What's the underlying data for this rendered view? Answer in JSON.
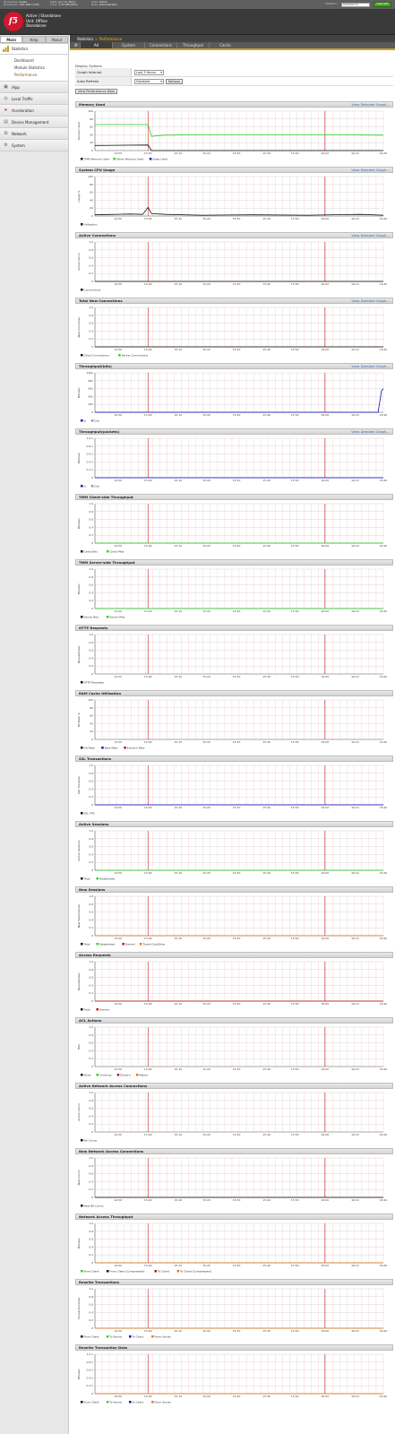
{
  "topbar": {
    "hostname_label": "Hostname:",
    "hostname": "bigip1",
    "ip_label": "IP Address:",
    "ip": "192.168.1.245",
    "date_label": "Date:",
    "date": "Jun 14, 2011",
    "time_label": "Time:",
    "time": "1:33 PM (PDT)",
    "user_label": "User:",
    "user": "admin",
    "role_label": "Role:",
    "role": "Administrator",
    "partition_label": "Partition:",
    "partition": "Common",
    "logout": "Log out"
  },
  "brand": {
    "logo": "f5",
    "status_lines": [
      "Active | Standalone",
      "Unit: Offline",
      "Standalone"
    ]
  },
  "sidebar": {
    "tabs": [
      {
        "label": "Main"
      },
      {
        "label": "Help"
      },
      {
        "label": "About"
      }
    ],
    "statistics": {
      "label": "Statistics",
      "icon": "chart-icon",
      "subitems": [
        {
          "label": "Dashboard"
        },
        {
          "label": "Module Statistics"
        },
        {
          "label": "Performance"
        }
      ]
    },
    "items": [
      {
        "label": "iApp",
        "icon": "iapp-icon"
      },
      {
        "label": "Local Traffic",
        "icon": "traffic-icon"
      },
      {
        "label": "Acceleration",
        "icon": "acceleration-icon"
      },
      {
        "label": "Device Management",
        "icon": "device-icon"
      },
      {
        "label": "Network",
        "icon": "network-icon"
      },
      {
        "label": "System",
        "icon": "system-icon"
      }
    ]
  },
  "breadcrumb": {
    "section": "Statistics",
    "sep": "»",
    "current": "Performance"
  },
  "tabs": [
    {
      "label": "All"
    },
    {
      "label": "System"
    },
    {
      "label": "Connections"
    },
    {
      "label": "Throughput"
    },
    {
      "label": "Cache"
    }
  ],
  "options": {
    "title": "Display Options",
    "interval_label": "Graph Interval",
    "interval_value": "Last 3 Hours",
    "refresh_label": "Auto Refresh",
    "refresh_value": "Disabled",
    "refresh_button": "Refresh",
    "detail_button": "View Performance Data"
  },
  "detail_link": "View Detailed Graph...",
  "x_ticks": [
    "14:50",
    "15:00",
    "15:10",
    "15:20",
    "15:30",
    "15:40",
    "15:50",
    "16:00",
    "16:10",
    "16:20"
  ],
  "colors": {
    "grid_h": "#d4d4d4",
    "grid_v": "#f0b7b7",
    "marker": "#cc2020",
    "axis": "#666",
    "green": "#2bd12b",
    "blue": "#0c0cc8",
    "black": "#111",
    "orange": "#e07a1a",
    "red": "#c01010",
    "gray": "#999"
  },
  "charts": [
    {
      "title": "Memory Used",
      "link": true,
      "ylabel": "Percent Used",
      "yticks": [
        "100",
        "80",
        "60",
        "40",
        "20",
        "0"
      ],
      "legend": [
        {
          "label": "TMM Memory Used",
          "color": "#111"
        },
        {
          "label": "Other Memory Used",
          "color": "#2bd12b"
        },
        {
          "label": "Swap Used",
          "color": "#0c0cc8"
        }
      ],
      "chart_data": {
        "type": "line",
        "series": [
          {
            "color": "#2bd12b",
            "points": [
              [
                14.7,
                66
              ],
              [
                15.0,
                66
              ],
              [
                15.02,
                36
              ],
              [
                15.06,
                38
              ],
              [
                15.1,
                39
              ],
              [
                15.3,
                40
              ],
              [
                16.0,
                40
              ],
              [
                16.33,
                39
              ]
            ]
          },
          {
            "color": "#111",
            "points": [
              [
                14.7,
                13
              ],
              [
                15.0,
                14
              ],
              [
                15.02,
                0
              ],
              [
                16.33,
                0
              ]
            ]
          }
        ]
      }
    },
    {
      "title": "System CPU Usage",
      "link": true,
      "ylabel": "Usage %",
      "yticks": [
        "100",
        "80",
        "60",
        "40",
        "20",
        "0"
      ],
      "legend": [
        {
          "label": "Utilization",
          "color": "#111"
        }
      ],
      "chart_data": {
        "type": "line",
        "series": [
          {
            "color": "#111",
            "points": [
              [
                14.7,
                3
              ],
              [
                14.9,
                5
              ],
              [
                14.97,
                4
              ],
              [
                15.0,
                22
              ],
              [
                15.02,
                6
              ],
              [
                15.1,
                4
              ],
              [
                15.3,
                2
              ],
              [
                15.6,
                3
              ],
              [
                15.9,
                2
              ],
              [
                16.2,
                4
              ],
              [
                16.33,
                2
              ]
            ]
          }
        ]
      }
    },
    {
      "title": "Active Connections",
      "link": true,
      "ylabel": "Active Conns",
      "yticks": [
        "1.0",
        "0.8",
        "0.6",
        "0.4",
        "0.2",
        "0"
      ],
      "legend": [
        {
          "label": "Connections",
          "color": "#111"
        }
      ],
      "chart_data": {
        "type": "line",
        "series": [
          {
            "color": "#111",
            "points": [
              [
                14.7,
                0
              ],
              [
                16.33,
                0
              ]
            ]
          }
        ]
      }
    },
    {
      "title": "Total New Connections",
      "link": true,
      "ylabel": "New Conns/sec",
      "yticks": [
        "1.0",
        "0.8",
        "0.6",
        "0.4",
        "0.2",
        "0"
      ],
      "legend": [
        {
          "label": "Client Connections",
          "color": "#111"
        },
        {
          "label": "Server Connections",
          "color": "#2bd12b"
        }
      ],
      "chart_data": {
        "type": "line",
        "series": [
          {
            "color": "#111",
            "points": [
              [
                14.7,
                0
              ],
              [
                16.33,
                0
              ]
            ]
          }
        ]
      }
    },
    {
      "title": "Throughput(bits)",
      "link": true,
      "ylabel": "Bits/sec",
      "yticks": [
        "100k",
        "80k",
        "60k",
        "40k",
        "20k",
        "0"
      ],
      "legend": [
        {
          "label": "In",
          "color": "#0c0cc8"
        },
        {
          "label": "Out",
          "color": "#999"
        }
      ],
      "chart_data": {
        "type": "line",
        "series": [
          {
            "color": "#0c0cc8",
            "points": [
              [
                14.7,
                0
              ],
              [
                16.3,
                0
              ],
              [
                16.32,
                55
              ],
              [
                16.33,
                60
              ]
            ]
          }
        ]
      }
    },
    {
      "title": "Throughput(packets)",
      "link": true,
      "ylabel": "Pkts/sec",
      "yticks": [
        "1.0 k",
        "0.8 k",
        "0.6 k",
        "0.4 k",
        "0.2 k",
        "0"
      ],
      "legend": [
        {
          "label": "In",
          "color": "#0c0cc8"
        },
        {
          "label": "Out",
          "color": "#999"
        }
      ],
      "chart_data": {
        "type": "line",
        "series": [
          {
            "color": "#0c0cc8",
            "points": [
              [
                14.7,
                0
              ],
              [
                16.33,
                0
              ]
            ]
          }
        ]
      }
    },
    {
      "title": "TMM Client-side Throughput",
      "link": false,
      "ylabel": "Bits/sec",
      "yticks": [
        "1.0",
        "0.8",
        "0.6",
        "0.4",
        "0.2",
        "0"
      ],
      "legend": [
        {
          "label": "Client Bits",
          "color": "#111"
        },
        {
          "label": "Client Pkts",
          "color": "#2bd12b"
        }
      ],
      "chart_data": {
        "type": "line",
        "series": [
          {
            "color": "#2bd12b",
            "points": [
              [
                14.7,
                0
              ],
              [
                16.33,
                0
              ]
            ]
          }
        ]
      }
    },
    {
      "title": "TMM Server-side Throughput",
      "link": false,
      "ylabel": "Bits/sec",
      "yticks": [
        "1.0",
        "0.8",
        "0.6",
        "0.4",
        "0.2",
        "0"
      ],
      "legend": [
        {
          "label": "Server Bits",
          "color": "#111"
        },
        {
          "label": "Server Pkts",
          "color": "#2bd12b"
        }
      ],
      "chart_data": {
        "type": "line",
        "series": [
          {
            "color": "#2bd12b",
            "points": [
              [
                14.7,
                0
              ],
              [
                16.33,
                0
              ]
            ]
          }
        ]
      }
    },
    {
      "title": "HTTP Requests",
      "link": false,
      "ylabel": "Requests/sec",
      "yticks": [
        "1.0",
        "0.8",
        "0.6",
        "0.4",
        "0.2",
        "0"
      ],
      "legend": [
        {
          "label": "HTTP Requests",
          "color": "#111"
        }
      ],
      "chart_data": {
        "type": "line",
        "series": []
      }
    },
    {
      "title": "RAM Cache Utilization",
      "link": false,
      "ylabel": "Hit Rate %",
      "yticks": [
        "100",
        "80",
        "60",
        "40",
        "20",
        "0"
      ],
      "legend": [
        {
          "label": "Hit Rate",
          "color": "#111"
        },
        {
          "label": "Byte Rate",
          "color": "#0c0cc8"
        },
        {
          "label": "Eviction Rate",
          "color": "#c01010"
        }
      ],
      "chart_data": {
        "type": "line",
        "series": []
      }
    },
    {
      "title": "SSL Transactions",
      "link": false,
      "ylabel": "SSL Trans/sec",
      "yticks": [
        "1.0",
        "0.8",
        "0.6",
        "0.4",
        "0.2",
        "0"
      ],
      "legend": [
        {
          "label": "SSL TPS",
          "color": "#111"
        }
      ],
      "chart_data": {
        "type": "line",
        "series": [
          {
            "color": "#0c0cc8",
            "points": [
              [
                14.7,
                0
              ],
              [
                16.33,
                0
              ]
            ]
          }
        ]
      }
    },
    {
      "title": "Active Sessions",
      "link": false,
      "ylabel": "Active Sessions",
      "yticks": [
        "1.0",
        "0.8",
        "0.6",
        "0.4",
        "0.2",
        "0"
      ],
      "legend": [
        {
          "label": "Total",
          "color": "#111"
        },
        {
          "label": "Established",
          "color": "#2bd12b"
        }
      ],
      "chart_data": {
        "type": "line",
        "series": [
          {
            "color": "#2bd12b",
            "points": [
              [
                14.7,
                0
              ],
              [
                16.33,
                0
              ]
            ]
          }
        ]
      }
    },
    {
      "title": "New Sessions",
      "link": false,
      "ylabel": "New Sessions/sec",
      "yticks": [
        "1.0",
        "0.8",
        "0.6",
        "0.4",
        "0.2",
        "0"
      ],
      "legend": [
        {
          "label": "Total",
          "color": "#111"
        },
        {
          "label": "Established",
          "color": "#2bd12b"
        },
        {
          "label": "Denied",
          "color": "#c01010"
        },
        {
          "label": "Timed Out/Other",
          "color": "#e07a1a"
        }
      ],
      "chart_data": {
        "type": "line",
        "series": [
          {
            "color": "#e07a1a",
            "points": [
              [
                14.7,
                0
              ],
              [
                16.33,
                0
              ]
            ]
          }
        ]
      }
    },
    {
      "title": "Access Requests",
      "link": false,
      "ylabel": "Requests/sec",
      "yticks": [
        "1.0",
        "0.8",
        "0.6",
        "0.4",
        "0.2",
        "0"
      ],
      "legend": [
        {
          "label": "Total",
          "color": "#111"
        },
        {
          "label": "Denied",
          "color": "#c01010"
        }
      ],
      "chart_data": {
        "type": "line",
        "series": [
          {
            "color": "#c01010",
            "points": [
              [
                14.7,
                0
              ],
              [
                16.33,
                0
              ]
            ]
          }
        ]
      }
    },
    {
      "title": "ACL Actions",
      "link": false,
      "ylabel": "Hits",
      "yticks": [
        "1.0",
        "0.8",
        "0.6",
        "0.4",
        "0.2",
        "0"
      ],
      "legend": [
        {
          "label": "Allow",
          "color": "#111"
        },
        {
          "label": "Continue",
          "color": "#2bd12b"
        },
        {
          "label": "Discard",
          "color": "#c01010"
        },
        {
          "label": "Reject",
          "color": "#e07a1a"
        }
      ],
      "chart_data": {
        "type": "line",
        "series": []
      }
    },
    {
      "title": "Active Network Access Connections",
      "link": false,
      "ylabel": "Active Conns",
      "yticks": [
        "1.0",
        "0.8",
        "0.6",
        "0.4",
        "0.2",
        "0"
      ],
      "legend": [
        {
          "label": "NA Conns",
          "color": "#111"
        }
      ],
      "chart_data": {
        "type": "line",
        "series": []
      }
    },
    {
      "title": "New Network Access Connections",
      "link": false,
      "ylabel": "New Conns",
      "yticks": [
        "1.0",
        "0.8",
        "0.6",
        "0.4",
        "0.2",
        "0"
      ],
      "legend": [
        {
          "label": "New NA Conns",
          "color": "#111"
        }
      ],
      "chart_data": {
        "type": "line",
        "series": [
          {
            "color": "#111",
            "points": [
              [
                14.7,
                0
              ],
              [
                16.33,
                0
              ]
            ]
          }
        ]
      }
    },
    {
      "title": "Network Access Throughput",
      "link": false,
      "ylabel": "Bits/sec",
      "yticks": [
        "1.0",
        "0.8",
        "0.6",
        "0.4",
        "0.2",
        "0"
      ],
      "legend": [
        {
          "label": "From Client",
          "color": "#2bd12b"
        },
        {
          "label": "From Client (Compressed)",
          "color": "#111"
        },
        {
          "label": "To Client",
          "color": "#c01010"
        },
        {
          "label": "To Client (Compressed)",
          "color": "#e07a1a"
        }
      ],
      "chart_data": {
        "type": "line",
        "series": [
          {
            "color": "#e07a1a",
            "points": [
              [
                14.7,
                0
              ],
              [
                16.33,
                0
              ]
            ]
          }
        ]
      }
    },
    {
      "title": "Rewrite Transactions",
      "link": false,
      "ylabel": "Transactions/sec",
      "yticks": [
        "1.0",
        "0.8",
        "0.6",
        "0.4",
        "0.2",
        "0"
      ],
      "legend": [
        {
          "label": "From Client",
          "color": "#111"
        },
        {
          "label": "To Server",
          "color": "#2bd12b"
        },
        {
          "label": "To Client",
          "color": "#0c0cc8"
        },
        {
          "label": "From Server",
          "color": "#e07a1a"
        }
      ],
      "chart_data": {
        "type": "line",
        "series": [
          {
            "color": "#e07a1a",
            "points": [
              [
                14.7,
                0
              ],
              [
                16.33,
                0
              ]
            ]
          }
        ]
      }
    },
    {
      "title": "Rewrite Transaction Data",
      "link": false,
      "ylabel": "Bits/sec",
      "yticks": [
        "1.0 k",
        "0.8 k",
        "0.6 k",
        "0.4 k",
        "0.2 k",
        "0"
      ],
      "legend": [
        {
          "label": "From Client",
          "color": "#111"
        },
        {
          "label": "To Server",
          "color": "#2bd12b"
        },
        {
          "label": "To Client",
          "color": "#0c0cc8"
        },
        {
          "label": "From Server",
          "color": "#e07a1a"
        }
      ],
      "chart_data": {
        "type": "line",
        "series": [
          {
            "color": "#e07a1a",
            "points": [
              [
                14.7,
                0
              ],
              [
                16.33,
                0
              ]
            ]
          }
        ]
      }
    }
  ]
}
